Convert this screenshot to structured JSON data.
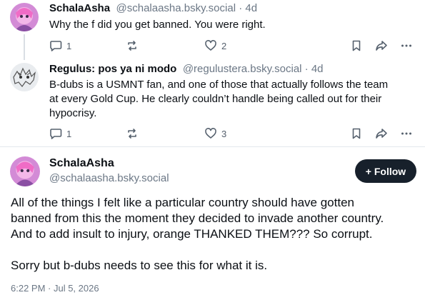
{
  "reply1": {
    "name": "SchalaAsha",
    "handle_time": "@schalaasha.bsky.social · 4d",
    "text": "Why the f did you get banned. You were right.",
    "replies": "1",
    "likes": "2"
  },
  "reply2": {
    "name": "Regulus: pos ya ni modo",
    "handle_time": "@regulustera.bsky.social · 4d",
    "lines": [
      "B-dubs is a USMNT fan, and one of those that actually follows the team",
      "at every Gold Cup. He clearly couldn’t handle being called out for their",
      "hypocrisy."
    ],
    "replies": "1",
    "likes": "3"
  },
  "main_post": {
    "name": "SchalaAsha",
    "handle": "@schalaasha.bsky.social",
    "follow_label": "+ Follow",
    "lines": [
      "All of the things I felt like a particular country should have gotten",
      "banned from this the moment they decided to invade another country.",
      "And to add insult to injury, orange THANKED THEM??? So corrupt.",
      "",
      "Sorry but b-dubs needs to see this for what it is."
    ],
    "timestamp": "6:22 PM · Jul 5, 2026"
  },
  "icons": [
    "reply-icon",
    "repost-icon",
    "like-icon",
    "bookmark-icon",
    "share-icon",
    "more-icon"
  ]
}
